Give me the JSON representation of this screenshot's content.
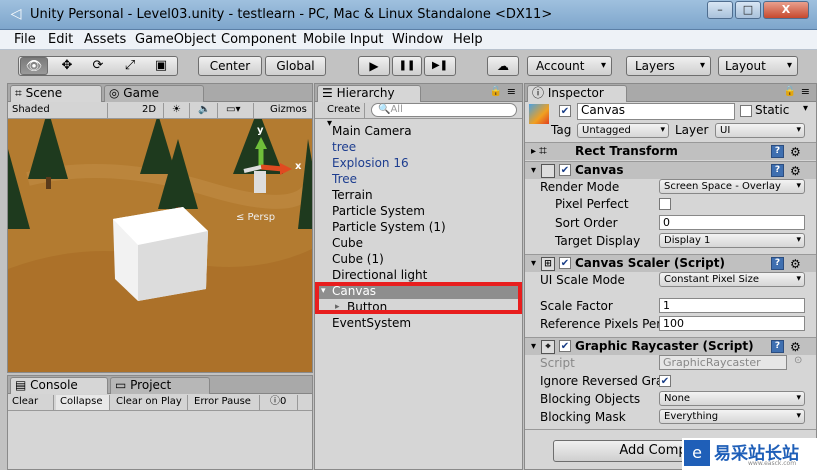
{
  "window": {
    "title": "Unity Personal - Level03.unity - testlearn - PC, Mac & Linux Standalone <DX11>",
    "min": "–",
    "max": "□",
    "close": "X"
  },
  "menu": [
    "File",
    "Edit",
    "Assets",
    "GameObject",
    "Component",
    "Mobile Input",
    "Window",
    "Help"
  ],
  "toolbar": {
    "center": "Center",
    "global": "Global",
    "layers": "Layers",
    "layout": "Layout",
    "play": "▶",
    "pause": "❚❚",
    "step": "▶❚",
    "cloud": "☁"
  },
  "scene": {
    "tab": "Scene",
    "game_tab": "Game",
    "shaded": "Shaded",
    "mode2d": "2D",
    "gizmos": "Gizmos",
    "persp": "≤ Persp",
    "axis_y": "y",
    "axis_x": "x"
  },
  "hierarchy": {
    "tab": "Hierarchy",
    "create": "Create",
    "search_placeholder": "All",
    "items": [
      {
        "label": "Main Camera",
        "color": "#000000"
      },
      {
        "label": "tree",
        "color": "#1d3d8f"
      },
      {
        "label": "Explosion 16",
        "color": "#1d3d8f"
      },
      {
        "label": "Tree",
        "color": "#1d3d8f"
      },
      {
        "label": "Terrain",
        "color": "#000000"
      },
      {
        "label": "Particle System",
        "color": "#000000"
      },
      {
        "label": "Particle System (1)",
        "color": "#000000"
      },
      {
        "label": "Cube",
        "color": "#000000"
      },
      {
        "label": "Cube (1)",
        "color": "#000000"
      },
      {
        "label": "Directional light",
        "color": "#000000"
      },
      {
        "label": "Canvas",
        "color": "#ffffff"
      },
      {
        "label": "Button",
        "color": "#000000"
      },
      {
        "label": "EventSystem",
        "color": "#000000"
      }
    ]
  },
  "console": {
    "tab": "Console",
    "project_tab": "Project",
    "buttons": [
      "Clear",
      "Collapse",
      "Clear on Play",
      "Error Pause"
    ],
    "count": "0"
  },
  "inspector": {
    "tab": "Inspector",
    "name": "Canvas",
    "static": "Static",
    "tag_label": "Tag",
    "tag": "Untagged",
    "layer_label": "Layer",
    "layer": "UI",
    "rect_transform": "Rect Transform",
    "canvas": {
      "title": "Canvas",
      "render_mode_label": "Render Mode",
      "render_mode": "Screen Space - Overlay",
      "pixel_perfect": "Pixel Perfect",
      "sort_order_label": "Sort Order",
      "sort_order": "0",
      "target_display_label": "Target Display",
      "target_display": "Display 1"
    },
    "scaler": {
      "title": "Canvas Scaler (Script)",
      "mode_label": "UI Scale Mode",
      "mode": "Constant Pixel Size",
      "factor_label": "Scale Factor",
      "factor": "1",
      "ref_label": "Reference Pixels Per",
      "ref": "100"
    },
    "raycaster": {
      "title": "Graphic Raycaster (Script)",
      "script_label": "Script",
      "script": "GraphicRaycaster",
      "ignore_label": "Ignore Reversed Gra",
      "blocking_objects_label": "Blocking Objects",
      "blocking_objects": "None",
      "blocking_mask_label": "Blocking Mask",
      "blocking_mask": "Everything"
    },
    "add_component": "Add Comp"
  },
  "watermark": {
    "text": "易采站长站",
    "sub": "www.easck.com"
  },
  "colors": {
    "selection_red": "#e81e1e",
    "selected_row": "#8e8e8e"
  }
}
